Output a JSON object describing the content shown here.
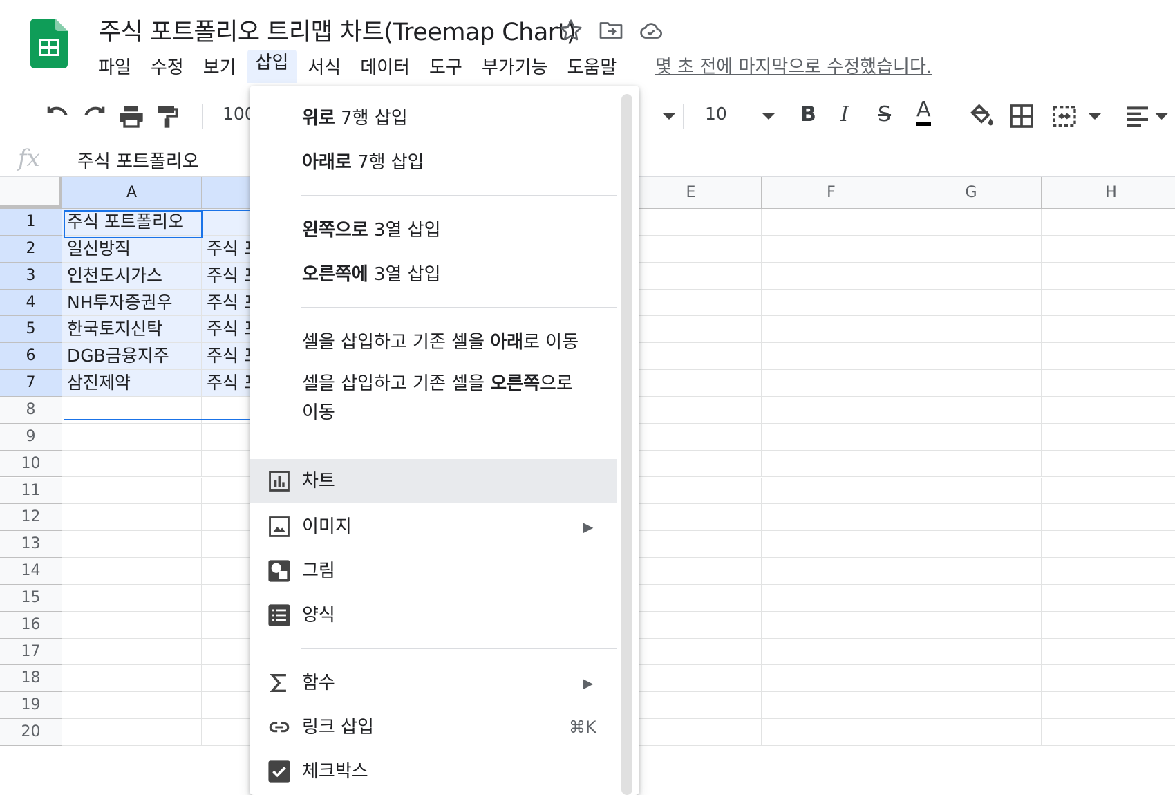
{
  "document": {
    "title": "주식 포트폴리오 트리맵 차트(Treemap Chart)",
    "last_edit": "몇 초 전에 마지막으로 수정했습니다."
  },
  "menubar": {
    "items": [
      "파일",
      "수정",
      "보기",
      "삽입",
      "서식",
      "데이터",
      "도구",
      "부가기능",
      "도움말"
    ],
    "active": "삽입"
  },
  "toolbar": {
    "zoom": "100",
    "font_size": "10",
    "bold": "B",
    "italic": "I",
    "strike": "S",
    "text_color": "A"
  },
  "formula_bar": {
    "fx": "fx",
    "value": "주식  포트폴리오"
  },
  "grid": {
    "columns": [
      "A",
      "",
      "",
      "",
      "E",
      "F",
      "G",
      "H"
    ],
    "rows": [
      "1",
      "2",
      "3",
      "4",
      "5",
      "6",
      "7",
      "8",
      "9",
      "10",
      "11",
      "12",
      "13",
      "14",
      "15",
      "16",
      "17",
      "18",
      "19",
      "20"
    ],
    "col_a": [
      "주식 포트폴리오",
      "일신방직",
      "인천도시가스",
      "NH투자증권우",
      "한국토지신탁",
      "DGB금융지주",
      "삼진제약"
    ],
    "col_b": [
      "",
      "주식 포",
      "주식 포",
      "주식 포",
      "주식 포",
      "주식 포",
      "주식 포"
    ]
  },
  "insert_menu": {
    "row_above": {
      "bold": "위로",
      "rest": " 7행 삽입"
    },
    "row_below": {
      "bold": "아래로",
      "rest": " 7행 삽입"
    },
    "col_left": {
      "bold": "왼쪽으로",
      "rest": " 3열 삽입"
    },
    "col_right": {
      "bold": "오른쪽에",
      "rest": " 3열 삽입"
    },
    "shift_down": {
      "pre": "셀을 삽입하고 기존 셀을 ",
      "bold": "아래",
      "post": "로 이동"
    },
    "shift_right": {
      "pre": "셀을 삽입하고 기존 셀을 ",
      "bold": "오른쪽",
      "post": "으로",
      "line2": "이동"
    },
    "chart": "차트",
    "image": "이미지",
    "drawing": "그림",
    "form": "양식",
    "function": "함수",
    "link": "링크 삽입",
    "link_shortcut": "⌘K",
    "checkbox": "체크박스",
    "submenu_arrow": "▶"
  },
  "colors": {
    "sheets_green": "#0f9d58",
    "selection_blue": "#1a73e8"
  }
}
